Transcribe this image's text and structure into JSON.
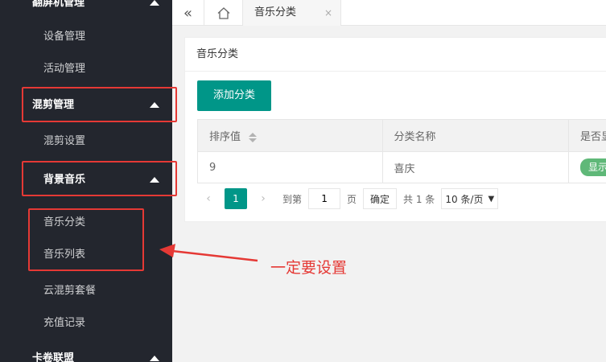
{
  "sidebar": {
    "items": [
      {
        "label": "翻屏机管理",
        "level": "top"
      },
      {
        "label": "设备管理",
        "level": "sub"
      },
      {
        "label": "活动管理",
        "level": "sub"
      },
      {
        "label": "混剪管理",
        "level": "top"
      },
      {
        "label": "混剪设置",
        "level": "sub"
      },
      {
        "label": "背景音乐",
        "level": "top2"
      },
      {
        "label": "音乐分类",
        "level": "sub"
      },
      {
        "label": "音乐列表",
        "level": "sub"
      },
      {
        "label": "云混剪套餐",
        "level": "sub"
      },
      {
        "label": "充值记录",
        "level": "sub"
      },
      {
        "label": "卡卷联盟",
        "level": "top"
      }
    ]
  },
  "tabs": {
    "collapse_icon": "double-chevron-left-icon",
    "home_icon": "home-icon",
    "active_tab": "音乐分类",
    "close_symbol": "×"
  },
  "card": {
    "title": "音乐分类",
    "add_button": "添加分类",
    "table": {
      "headers": [
        "排序值",
        "分类名称",
        "是否显示"
      ],
      "rows": [
        {
          "sort": "9",
          "name": "喜庆",
          "status": "显示"
        }
      ]
    },
    "pager": {
      "prev": "‹",
      "current_page": "1",
      "next": "›",
      "goto_label": "到第",
      "goto_value": "1",
      "page_unit": "页",
      "confirm": "确定",
      "total": "共 1 条",
      "page_size": "10 条/页"
    }
  },
  "annotation": {
    "text": "一定要设置",
    "color": "#e53935"
  },
  "colors": {
    "sidebar_bg": "#23262e",
    "accent": "#009688",
    "badge": "#5fb878"
  }
}
